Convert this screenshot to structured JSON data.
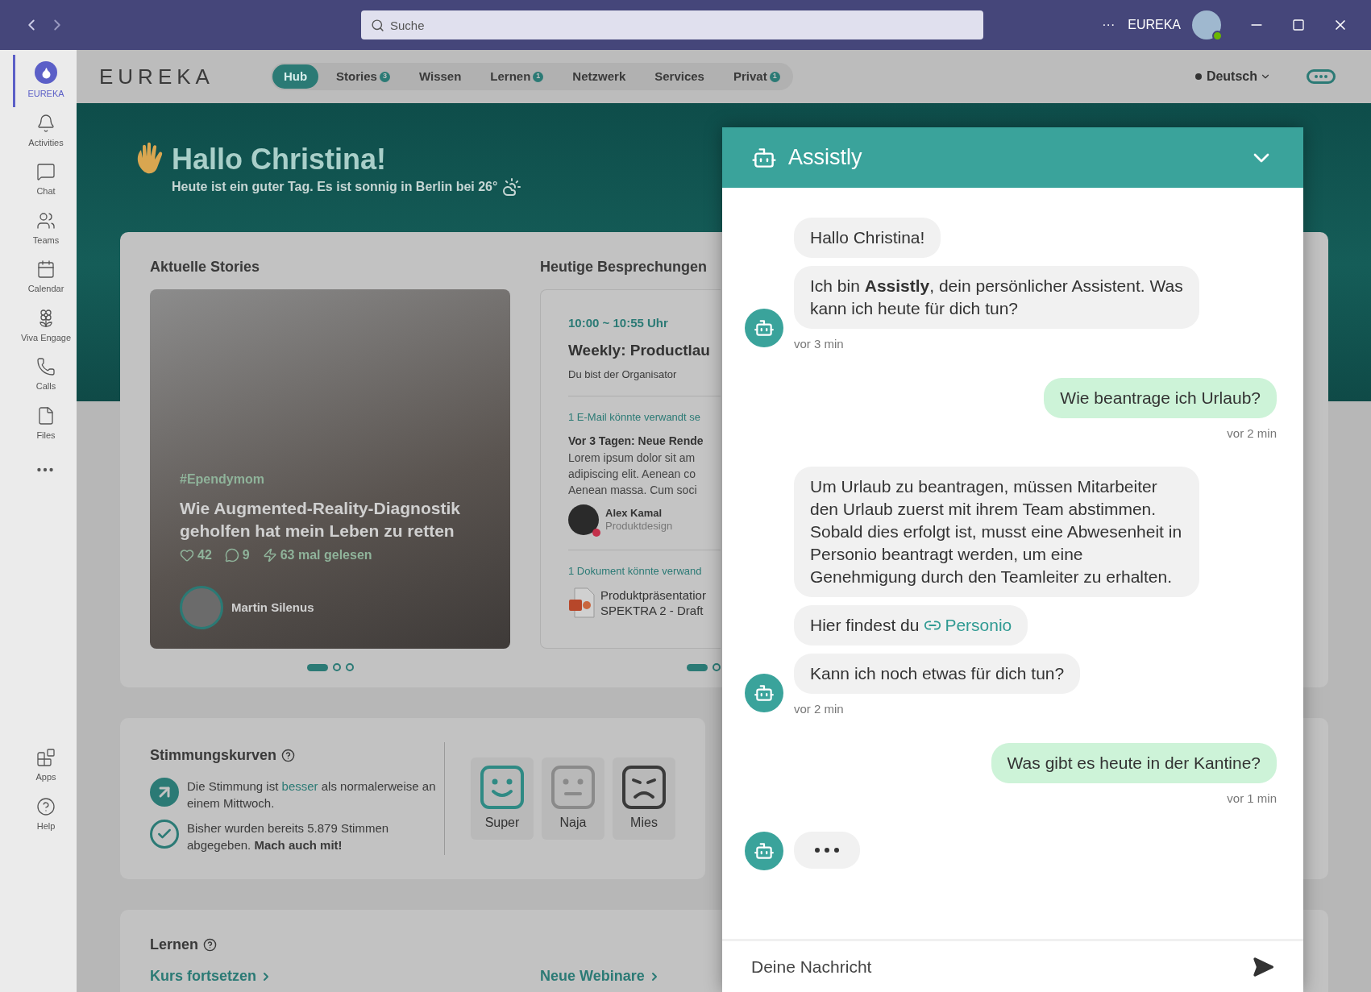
{
  "title_bar": {
    "search": {
      "placeholder": "Suche"
    },
    "more": "···",
    "org": "EUREKA"
  },
  "rail": {
    "items": [
      {
        "label": "EUREKA",
        "selected": true
      },
      {
        "label": "Activities",
        "selected": false
      },
      {
        "label": "Chat",
        "selected": false
      },
      {
        "label": "Teams",
        "selected": false
      },
      {
        "label": "Calendar",
        "selected": false
      },
      {
        "label": "Viva Engage",
        "selected": false
      },
      {
        "label": "Calls",
        "selected": false
      },
      {
        "label": "Files",
        "selected": false
      }
    ],
    "bottom_items": [
      {
        "label": "Apps",
        "selected": false
      },
      {
        "label": "Help",
        "selected": false
      }
    ]
  },
  "nav": {
    "logo": "EUREKA",
    "tabs": [
      {
        "label": "Hub",
        "selected": true
      },
      {
        "label": "Stories",
        "badge": "3",
        "selected": false
      },
      {
        "label": "Wissen",
        "selected": false
      },
      {
        "label": "Lernen",
        "badge": "1",
        "selected": false
      },
      {
        "label": "Netzwerk",
        "selected": false
      },
      {
        "label": "Services",
        "selected": false
      },
      {
        "label": "Privat",
        "badge": "1",
        "selected": false
      }
    ],
    "language": "Deutsch"
  },
  "hero": {
    "greeting": "Hallo Christina!",
    "subtitle": "Heute ist ein guter Tag. Es ist sonnig in Berlin bei 26°"
  },
  "stories": {
    "title": "Aktuelle Stories",
    "story": {
      "tag": "#Ependymom",
      "title": "Wie Augmented-Reality-Diagnostik geholfen hat mein Leben zu retten",
      "likes": "42",
      "comments": "9",
      "reads": "63 mal gelesen",
      "author": "Martin Silenus"
    },
    "dots": [
      {
        "selected": true
      },
      {
        "selected": false
      },
      {
        "selected": false
      }
    ]
  },
  "meetings": {
    "title": "Heutige Besprechungen",
    "meeting": {
      "time": "10:00 ~ 10:55 Uhr",
      "title": "Weekly: Productlau",
      "role": "Du bist der Organisator",
      "email_label": "1 E-Mail könnte verwandt se",
      "email_subject": "Vor 3 Tagen: Neue Rende",
      "email_body": [
        "Lorem ipsum dolor sit am",
        "adipiscing elit. Aenean co",
        "Aenean massa. Cum soci"
      ],
      "person": {
        "name": "Alex Kamal",
        "role": "Produktdesign"
      },
      "doc_label": "1 Dokument könnte verwand",
      "doc_name": [
        "Produktpräsentatior",
        "SPEKTRA 2 - Draft"
      ]
    },
    "dots": [
      {
        "selected": true
      },
      {
        "selected": false
      }
    ]
  },
  "mood": {
    "title": "Stimmungskurven",
    "trend": {
      "before": "Die Stimmung ist ",
      "highlight": "besser",
      "after": " als normalerweise an einem Mittwoch."
    },
    "votes": "Bisher wurden bereits 5.879 Stimmen abgegeben. **Mach auch mit!**",
    "options": [
      {
        "kind": "happy",
        "label": "Super"
      },
      {
        "kind": "neutral",
        "label": "Naja"
      },
      {
        "kind": "sad",
        "label": "Mies"
      }
    ]
  },
  "learning": {
    "title": "Lernen",
    "links": [
      "Kurs fortsetzen",
      "Neue Webinare"
    ]
  },
  "chat": {
    "title": "Assistly",
    "groups": [
      {
        "kind": "bot",
        "bubbles": [
          {
            "kind": "text",
            "text": "Hallo Christina!"
          },
          {
            "kind": "text",
            "text": "Ich bin **Assistly**, dein persönlicher Assistent. Was kann ich heute für dich tun?"
          }
        ],
        "time": "vor 3 min"
      },
      {
        "kind": "user",
        "bubbles": [
          {
            "kind": "text",
            "text": "Wie beantrage ich Urlaub?"
          }
        ],
        "time": "vor 2 min"
      },
      {
        "kind": "bot",
        "bubbles": [
          {
            "kind": "text",
            "text": "Um Urlaub zu beantragen, müssen Mitarbeiter den Urlaub zuerst mit ihrem Team abstimmen. Sobald dies erfolgt ist, musst eine Abwesenheit in Personio beantragt werden, um eine Genehmigung durch den Teamleiter zu erhalten."
          },
          {
            "kind": "link",
            "text": "Hier findest du",
            "link": "Personio"
          },
          {
            "kind": "text",
            "text": "Kann ich noch etwas für dich tun?"
          }
        ],
        "time": "vor 2 min"
      },
      {
        "kind": "user",
        "bubbles": [
          {
            "kind": "text",
            "text": "Was gibt es heute in der Kantine?"
          }
        ],
        "time": "vor 1 min"
      },
      {
        "kind": "bot",
        "bubbles": [
          {
            "kind": "typing"
          }
        ]
      }
    ],
    "input": {
      "placeholder": "Deine Nachricht"
    }
  }
}
